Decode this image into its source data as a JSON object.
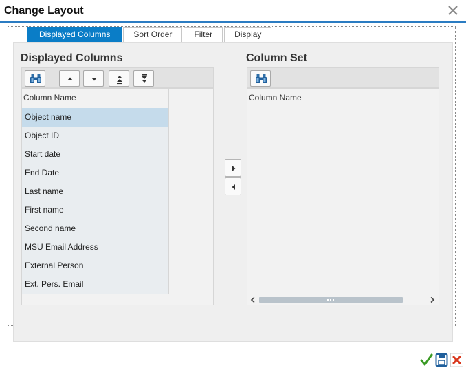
{
  "dialog": {
    "title": "Change Layout"
  },
  "tabs": [
    {
      "label": "Displayed Columns",
      "active": true
    },
    {
      "label": "Sort Order",
      "active": false
    },
    {
      "label": "Filter",
      "active": false
    },
    {
      "label": "Display",
      "active": false
    }
  ],
  "left": {
    "title": "Displayed Columns",
    "column_header": "Column Name",
    "rows": [
      "Object name",
      "Object ID",
      "Start date",
      "End Date",
      "Last name",
      "First name",
      "Second name",
      "MSU Email Address",
      "External Person",
      "Ext. Pers. Email"
    ],
    "selected_index": 0
  },
  "right": {
    "title": "Column Set",
    "column_header": "Column Name"
  },
  "colors": {
    "accent": "#0a7dc7",
    "selection": "#c5dbeb",
    "confirm": "#3a9a24",
    "cancel": "#d9381e"
  },
  "icons": [
    "close-icon",
    "binoculars-icon",
    "arrow-up-icon",
    "arrow-down-icon",
    "move-top-icon",
    "move-bottom-icon",
    "arrow-right-icon",
    "arrow-left-icon",
    "checkmark-icon",
    "save-icon",
    "cancel-icon"
  ]
}
